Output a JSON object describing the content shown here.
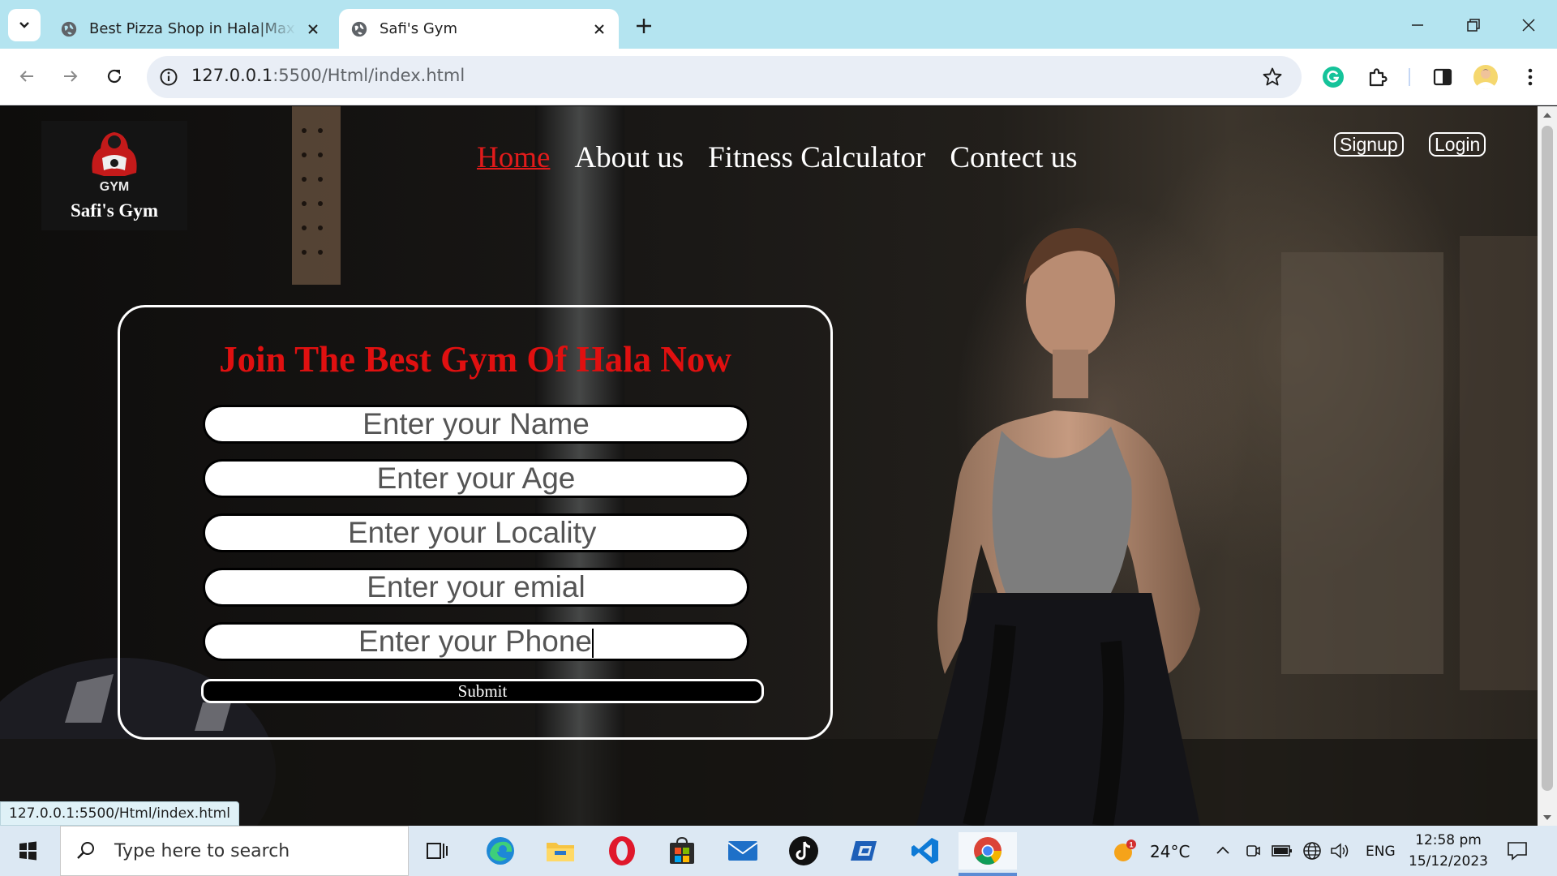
{
  "browser": {
    "tabs": [
      {
        "title": "Best Pizza Shop in Hala|Maxislice",
        "active": false
      },
      {
        "title": "Safi's Gym",
        "active": true
      }
    ],
    "url_host": "127.0.0.1",
    "url_path": ":5500/Html/index.html",
    "status_url": "127.0.0.1:5500/Html/index.html"
  },
  "site": {
    "logo_text": "GYM",
    "brand_name": "Safi's Gym",
    "nav": [
      "Home",
      "About us",
      "Fitness Calculator",
      "Contect us"
    ],
    "auth": {
      "signup": "Signup",
      "login": "Login"
    },
    "form": {
      "title": "Join The Best Gym Of Hala Now",
      "fields": [
        {
          "placeholder": "Enter your Name"
        },
        {
          "placeholder": "Enter your Age"
        },
        {
          "placeholder": "Enter your Locality"
        },
        {
          "placeholder": "Enter your emial"
        },
        {
          "placeholder": "Enter your Phone"
        }
      ],
      "submit": "Submit"
    }
  },
  "taskbar": {
    "search_placeholder": "Type here to search",
    "weather": "24°C",
    "weather_badge": "1",
    "lang": "ENG",
    "time": "12:58 pm",
    "date": "15/12/2023"
  },
  "colors": {
    "accent_red": "#e01010",
    "tabstrip": "#b4e4f0",
    "taskbar": "#dce8f3"
  }
}
